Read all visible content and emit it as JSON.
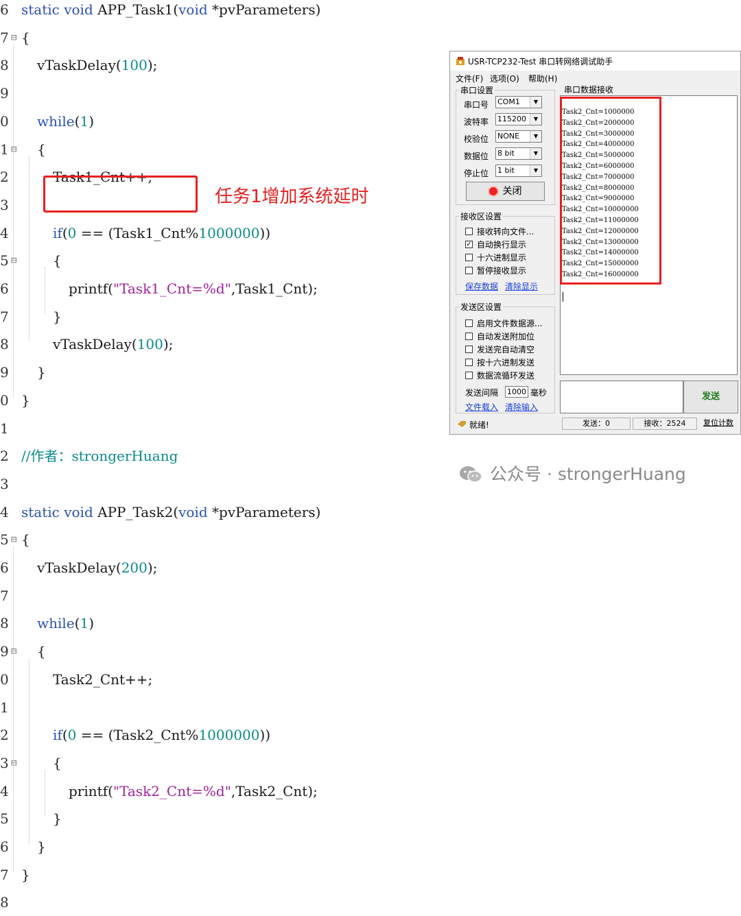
{
  "editor": {
    "lines": [
      {
        "ln": "6",
        "fold": "",
        "indent": 0,
        "segs": [
          [
            "kw",
            "static void "
          ],
          [
            "",
            "APP_Task1("
          ],
          [
            "kw",
            "void"
          ],
          [
            "",
            " *pvParameters)"
          ]
        ]
      },
      {
        "ln": "7",
        "fold": "⊟",
        "indent": 0,
        "segs": [
          [
            "",
            "{"
          ]
        ]
      },
      {
        "ln": "8",
        "fold": "",
        "indent": 1,
        "segs": [
          [
            "",
            "vTaskDelay("
          ],
          [
            "num",
            "100"
          ],
          [
            "",
            ");"
          ]
        ]
      },
      {
        "ln": "9",
        "fold": "",
        "indent": 1,
        "segs": []
      },
      {
        "ln": "0",
        "fold": "",
        "indent": 1,
        "segs": [
          [
            "kw",
            "while"
          ],
          [
            "",
            "("
          ],
          [
            "num",
            "1"
          ],
          [
            "",
            ")"
          ]
        ]
      },
      {
        "ln": "1",
        "fold": "⊟",
        "indent": 1,
        "segs": [
          [
            "",
            "{"
          ]
        ]
      },
      {
        "ln": "2",
        "fold": "",
        "indent": 2,
        "segs": [
          [
            "",
            "Task1_Cnt++;"
          ]
        ]
      },
      {
        "ln": "3",
        "fold": "",
        "indent": 2,
        "segs": []
      },
      {
        "ln": "4",
        "fold": "",
        "indent": 2,
        "segs": [
          [
            "kw",
            "if"
          ],
          [
            "",
            "("
          ],
          [
            "num",
            "0"
          ],
          [
            "",
            " == (Task1_Cnt%"
          ],
          [
            "num",
            "1000000"
          ],
          [
            "",
            "))"
          ]
        ]
      },
      {
        "ln": "5",
        "fold": "⊟",
        "indent": 2,
        "segs": [
          [
            "",
            "{"
          ]
        ]
      },
      {
        "ln": "6",
        "fold": "",
        "indent": 3,
        "segs": [
          [
            "",
            "printf("
          ],
          [
            "str",
            "\"Task1_Cnt=%d\""
          ],
          [
            "",
            ",Task1_Cnt);"
          ]
        ]
      },
      {
        "ln": "7",
        "fold": "",
        "indent": 2,
        "segs": [
          [
            "",
            "}"
          ]
        ]
      },
      {
        "ln": "8",
        "fold": "",
        "indent": 2,
        "segs": [
          [
            "",
            "vTaskDelay("
          ],
          [
            "num",
            "100"
          ],
          [
            "",
            ");"
          ]
        ]
      },
      {
        "ln": "9",
        "fold": "",
        "indent": 1,
        "segs": [
          [
            "",
            "}"
          ]
        ]
      },
      {
        "ln": "0",
        "fold": "",
        "indent": 0,
        "segs": [
          [
            "",
            "}"
          ]
        ]
      },
      {
        "ln": "1",
        "fold": "",
        "indent": 0,
        "segs": []
      },
      {
        "ln": "2",
        "fold": "",
        "indent": 0,
        "segs": [
          [
            "cmt",
            "//作者：strongerHuang"
          ]
        ]
      },
      {
        "ln": "3",
        "fold": "",
        "indent": 0,
        "segs": []
      },
      {
        "ln": "4",
        "fold": "",
        "indent": 0,
        "segs": [
          [
            "kw",
            "static void "
          ],
          [
            "",
            "APP_Task2("
          ],
          [
            "kw",
            "void"
          ],
          [
            "",
            " *pvParameters)"
          ]
        ]
      },
      {
        "ln": "5",
        "fold": "⊟",
        "indent": 0,
        "segs": [
          [
            "",
            "{"
          ]
        ]
      },
      {
        "ln": "6",
        "fold": "",
        "indent": 1,
        "segs": [
          [
            "",
            "vTaskDelay("
          ],
          [
            "num",
            "200"
          ],
          [
            "",
            ");"
          ]
        ]
      },
      {
        "ln": "7",
        "fold": "",
        "indent": 1,
        "segs": []
      },
      {
        "ln": "8",
        "fold": "",
        "indent": 1,
        "segs": [
          [
            "kw",
            "while"
          ],
          [
            "",
            "("
          ],
          [
            "num",
            "1"
          ],
          [
            "",
            ")"
          ]
        ]
      },
      {
        "ln": "9",
        "fold": "⊟",
        "indent": 1,
        "segs": [
          [
            "",
            "{"
          ]
        ]
      },
      {
        "ln": "0",
        "fold": "",
        "indent": 2,
        "segs": [
          [
            "",
            "Task2_Cnt++;"
          ]
        ]
      },
      {
        "ln": "1",
        "fold": "",
        "indent": 2,
        "segs": []
      },
      {
        "ln": "2",
        "fold": "",
        "indent": 2,
        "segs": [
          [
            "kw",
            "if"
          ],
          [
            "",
            "("
          ],
          [
            "num",
            "0"
          ],
          [
            "",
            " == (Task2_Cnt%"
          ],
          [
            "num",
            "1000000"
          ],
          [
            "",
            "))"
          ]
        ]
      },
      {
        "ln": "3",
        "fold": "⊟",
        "indent": 2,
        "segs": [
          [
            "",
            "{"
          ]
        ]
      },
      {
        "ln": "4",
        "fold": "",
        "indent": 3,
        "segs": [
          [
            "",
            "printf("
          ],
          [
            "str",
            "\"Task2_Cnt=%d\""
          ],
          [
            "",
            ",Task2_Cnt);"
          ]
        ]
      },
      {
        "ln": "5",
        "fold": "",
        "indent": 2,
        "segs": [
          [
            "",
            "}"
          ]
        ]
      },
      {
        "ln": "6",
        "fold": "",
        "indent": 1,
        "segs": [
          [
            "",
            "}"
          ]
        ]
      },
      {
        "ln": "7",
        "fold": "",
        "indent": 0,
        "segs": [
          [
            "",
            "}"
          ]
        ]
      },
      {
        "ln": "8",
        "fold": "",
        "indent": 0,
        "segs": []
      }
    ]
  },
  "annotation": {
    "text": "任务1增加系统延时",
    "color": "#e62020"
  },
  "serial_tool": {
    "title": "USR-TCP232-Test 串口转网络调试助手",
    "menu": [
      "文件(F)",
      "选项(O)",
      "帮助(H)"
    ],
    "serial_settings": {
      "title": "串口设置",
      "fields": [
        {
          "label": "串口号",
          "value": "COM1"
        },
        {
          "label": "波特率",
          "value": "115200"
        },
        {
          "label": "校验位",
          "value": "NONE"
        },
        {
          "label": "数据位",
          "value": "8 bit"
        },
        {
          "label": "停止位",
          "value": "1 bit"
        }
      ],
      "close_button": "关闭"
    },
    "receive_settings": {
      "title": "接收区设置",
      "options": [
        {
          "label": "接收转向文件...",
          "checked": false
        },
        {
          "label": "自动换行显示",
          "checked": true
        },
        {
          "label": "十六进制显示",
          "checked": false
        },
        {
          "label": "暂停接收显示",
          "checked": false
        }
      ],
      "save_link": "保存数据",
      "clear_link": "清除显示"
    },
    "send_settings": {
      "title": "发送区设置",
      "options": [
        {
          "label": "启用文件数据源...",
          "checked": false
        },
        {
          "label": "自动发送附加位",
          "checked": false
        },
        {
          "label": "发送完自动清空",
          "checked": false
        },
        {
          "label": "按十六进制发送",
          "checked": false
        },
        {
          "label": "数据流循环发送",
          "checked": false
        }
      ],
      "interval_label": "发送间隔",
      "interval_value": "1000",
      "interval_unit": "毫秒",
      "load_link": "文件载入",
      "clear_input_link": "清除输入"
    },
    "receive_panel": {
      "title": "串口数据接收",
      "lines": [
        "Task2_Cnt=1000000",
        "Task2_Cnt=2000000",
        "Task2_Cnt=3000000",
        "Task2_Cnt=4000000",
        "Task2_Cnt=5000000",
        "Task2_Cnt=6000000",
        "Task2_Cnt=7000000",
        "Task2_Cnt=8000000",
        "Task2_Cnt=9000000",
        "Task2_Cnt=10000000",
        "Task2_Cnt=11000000",
        "Task2_Cnt=12000000",
        "Task2_Cnt=13000000",
        "Task2_Cnt=14000000",
        "Task2_Cnt=15000000",
        "Task2_Cnt=16000000"
      ]
    },
    "send_button": "发送",
    "status": {
      "ready": "就绪!",
      "sent": "发送：0",
      "received": "接收：2524",
      "reset": "复位计数"
    }
  },
  "watermark": {
    "text": "公众号 · strongerHuang"
  }
}
